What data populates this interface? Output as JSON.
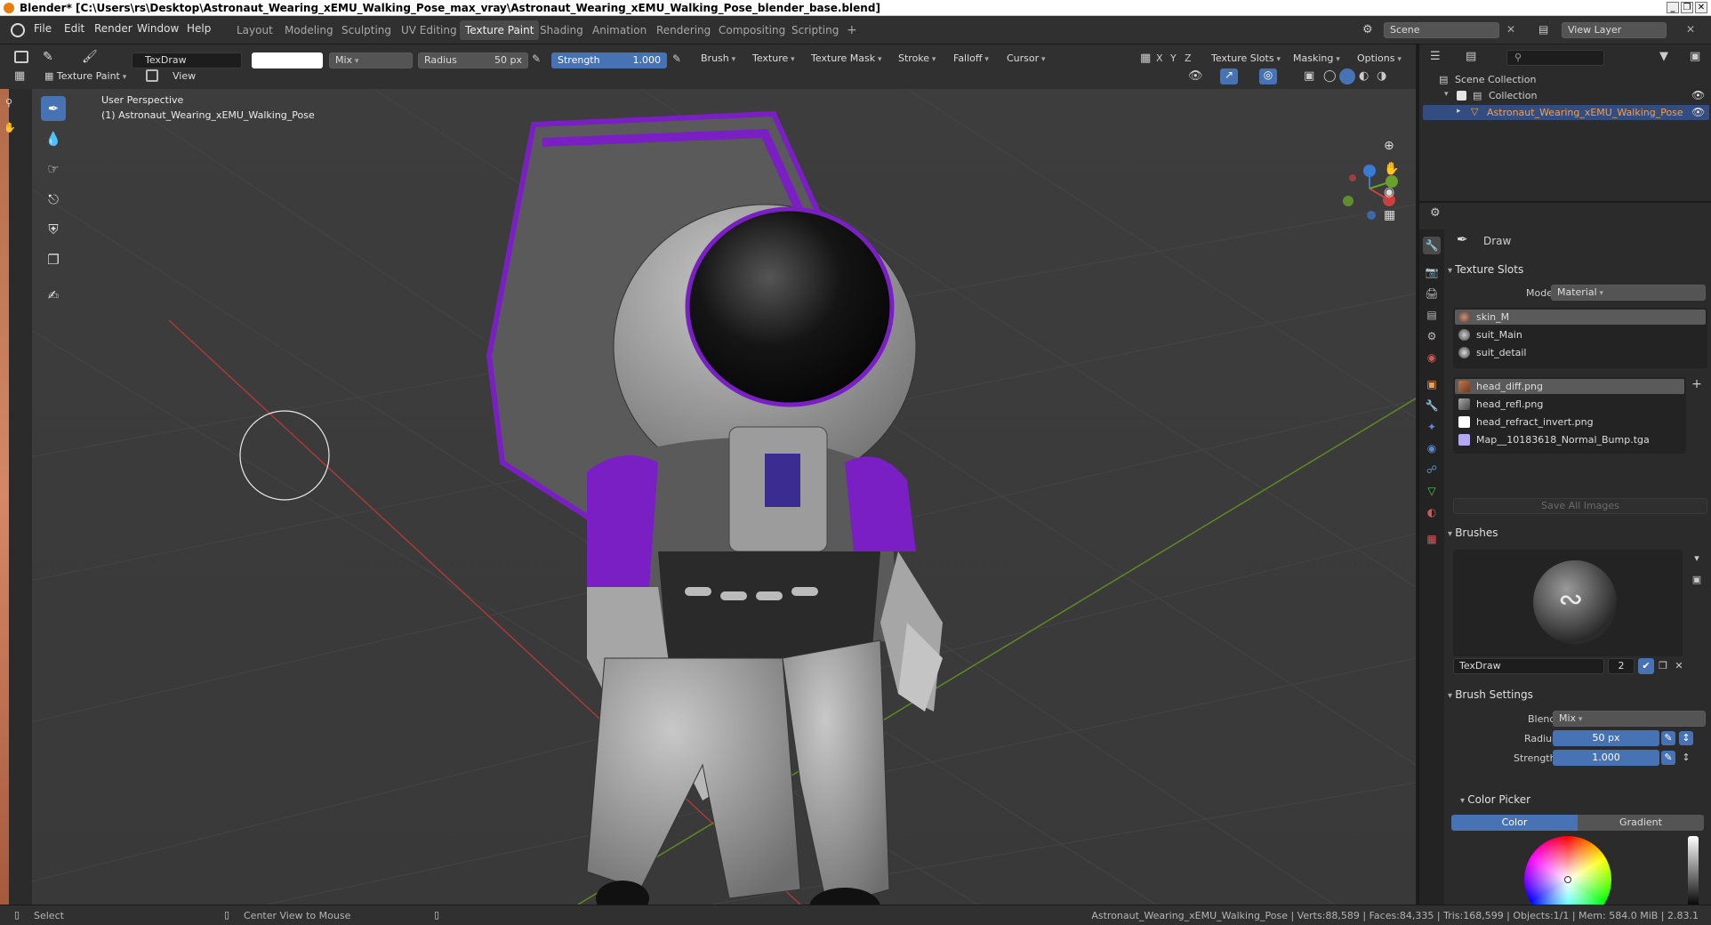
{
  "window": {
    "title": "Blender* [C:\\Users\\rs\\Desktop\\Astronaut_Wearing_xEMU_Walking_Pose_max_vray\\Astronaut_Wearing_xEMU_Walking_Pose_blender_base.blend]",
    "controls": [
      "_",
      "❐",
      "✕"
    ]
  },
  "menubar": {
    "items": [
      "File",
      "Edit",
      "Render",
      "Window",
      "Help"
    ]
  },
  "workspaces": {
    "tabs": [
      "Layout",
      "Modeling",
      "Sculpting",
      "UV Editing",
      "Texture Paint",
      "Shading",
      "Animation",
      "Rendering",
      "Compositing",
      "Scripting"
    ],
    "active": "Texture Paint",
    "add": "+"
  },
  "scene": {
    "label": "Scene",
    "view_layer": "View Layer"
  },
  "tool_header": {
    "brush_name": "TexDraw",
    "blend": "Mix",
    "radius_label": "Radius",
    "radius_value": "50 px",
    "strength_label": "Strength",
    "strength_value": "1.000",
    "menus": [
      "Brush",
      "Texture",
      "Texture Mask",
      "Stroke",
      "Falloff",
      "Cursor"
    ],
    "axes": [
      "X",
      "Y",
      "Z"
    ],
    "right_menus": [
      "Texture Slots",
      "Masking",
      "Options"
    ]
  },
  "viewport_header": {
    "mode": "Texture Paint",
    "view": "View"
  },
  "viewport": {
    "perspective": "User Perspective",
    "object_label": "(1) Astronaut_Wearing_xEMU_Walking_Pose"
  },
  "outliner": {
    "scene_collection": "Scene Collection",
    "collection": "Collection",
    "object": "Astronaut_Wearing_xEMU_Walking_Pose"
  },
  "properties": {
    "tool_name": "Draw",
    "texture_slots": {
      "title": "Texture Slots",
      "mode_label": "Mode",
      "mode_value": "Material",
      "materials": [
        "skin_M",
        "suit_Main",
        "suit_detail"
      ],
      "images": [
        "head_diff.png",
        "head_refl.png",
        "head_refract_invert.png",
        "Map__10183618_Normal_Bump.tga"
      ],
      "save_all": "Save All Images"
    },
    "brushes": {
      "title": "Brushes",
      "name": "TexDraw",
      "users": "2"
    },
    "brush_settings": {
      "title": "Brush Settings",
      "blend_label": "Blend",
      "blend_value": "Mix",
      "radius_label": "Radius",
      "radius_value": "50 px",
      "strength_label": "Strength",
      "strength_value": "1.000"
    },
    "color_picker": {
      "title": "Color Picker",
      "tab_color": "Color",
      "tab_gradient": "Gradient"
    }
  },
  "statusbar": {
    "select": "Select",
    "center": "Center View to Mouse",
    "stats": "Astronaut_Wearing_xEMU_Walking_Pose | Verts:88,589 | Faces:84,335 | Tris:168,599 | Objects:1/1 | Mem: 584.0 MiB | 2.83.1"
  },
  "colors": {
    "accent": "#4772b3",
    "suit_purple": "#7a1fc4",
    "grid_x": "#c83c3c",
    "grid_y": "#6a9a2a"
  }
}
